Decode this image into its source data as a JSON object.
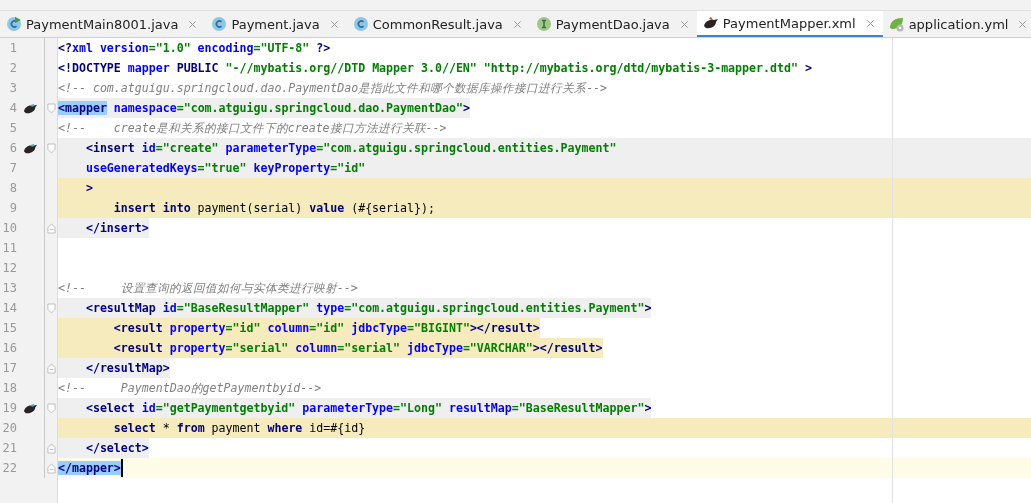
{
  "tabs": [
    {
      "label": "PaymentMain8001.java",
      "kind": "runnable-class",
      "selected": false
    },
    {
      "label": "Payment.java",
      "kind": "class",
      "selected": false
    },
    {
      "label": "CommonResult.java",
      "kind": "class",
      "selected": false
    },
    {
      "label": "PaymentDao.java",
      "kind": "interface",
      "selected": false
    },
    {
      "label": "PaymentMapper.xml",
      "kind": "mapper",
      "selected": true
    },
    {
      "label": "application.yml",
      "kind": "config",
      "selected": false
    }
  ],
  "lines": [
    {
      "number": "1",
      "kind": "plain",
      "tokens": [
        {
          "kind": "tag",
          "t": "<?"
        },
        {
          "kind": "attr",
          "t": "xml version"
        },
        {
          "kind": "str",
          "t": "=\"1.0\""
        },
        {
          "kind": "attr",
          "t": " encoding"
        },
        {
          "kind": "str",
          "t": "=\"UTF-8\""
        },
        {
          "kind": "tag",
          "t": " ?>"
        }
      ]
    },
    {
      "number": "2",
      "kind": "plain",
      "tokens": [
        {
          "kind": "tag",
          "t": "<!DOCTYPE "
        },
        {
          "kind": "attr",
          "t": "mapper"
        },
        {
          "kind": "tag",
          "t": " PUBLIC "
        },
        {
          "kind": "str",
          "t": "\"-//mybatis.org//DTD Mapper 3.0//EN\" \"http://mybatis.org/dtd/mybatis-3-mapper.dtd\""
        },
        {
          "kind": "tag",
          "t": " >"
        }
      ]
    },
    {
      "number": "3",
      "kind": "plain",
      "tokens": [
        {
          "kind": "comment",
          "t": "<!-- com.atguigu.springcloud.dao.PaymentDao是指此文件和哪个数据库操作接口进行关系-->"
        }
      ]
    },
    {
      "number": "4",
      "kind": "tag",
      "gutter_icon": true,
      "fold_start": true,
      "tokens": [
        {
          "kind": "match",
          "t": "<mapper"
        },
        {
          "kind": "attr",
          "t": " namespace"
        },
        {
          "kind": "str",
          "t": "=\"com.atguigu.springcloud.dao.PaymentDao\""
        },
        {
          "kind": "tag",
          "t": ">"
        }
      ]
    },
    {
      "number": "5",
      "kind": "plain",
      "tokens": [
        {
          "kind": "comment",
          "t": "<!--    create是和关系的接口文件下的create接口方法进行关联-->"
        }
      ]
    },
    {
      "number": "6",
      "kind": "tag-full",
      "gutter_icon": true,
      "fold_start": true,
      "tokens": [
        {
          "kind": "tag",
          "t": "    <insert"
        },
        {
          "kind": "attr",
          "t": " id"
        },
        {
          "kind": "str",
          "t": "=\"create\""
        },
        {
          "kind": "attr",
          "t": " parameterType"
        },
        {
          "kind": "str",
          "t": "=\"com.atguigu.springcloud.entities.Payment\""
        }
      ]
    },
    {
      "number": "7",
      "kind": "tag-full",
      "tokens": [
        {
          "kind": "attr",
          "t": "    useGeneratedKeys"
        },
        {
          "kind": "str",
          "t": "=\"true\""
        },
        {
          "kind": "attr",
          "t": " keyProperty"
        },
        {
          "kind": "str",
          "t": "=\"id\""
        }
      ]
    },
    {
      "number": "8",
      "kind": "body-full",
      "tokens": [
        {
          "kind": "tag",
          "t": "    >"
        }
      ]
    },
    {
      "number": "9",
      "kind": "body-full",
      "tokens": [
        {
          "kind": "keyword",
          "t": "        insert into"
        },
        {
          "kind": "text",
          "t": " payment(serial) "
        },
        {
          "kind": "keyword",
          "t": "value"
        },
        {
          "kind": "text",
          "t": " (#{serial});"
        }
      ]
    },
    {
      "number": "10",
      "kind": "tag",
      "fold_end": true,
      "tokens": [
        {
          "kind": "tag",
          "t": "    </insert>"
        }
      ]
    },
    {
      "number": "11",
      "kind": "plain"
    },
    {
      "number": "12",
      "kind": "plain"
    },
    {
      "number": "13",
      "kind": "plain",
      "tokens": [
        {
          "kind": "comment",
          "t": "<!--     设置查询的返回值如何与实体类进行映射-->"
        }
      ]
    },
    {
      "number": "14",
      "kind": "tag",
      "fold_start": true,
      "tokens": [
        {
          "kind": "tag",
          "t": "    <resultMap"
        },
        {
          "kind": "attr",
          "t": " id"
        },
        {
          "kind": "str",
          "t": "=\"BaseResultMapper\""
        },
        {
          "kind": "attr",
          "t": " type"
        },
        {
          "kind": "str",
          "t": "=\"com.atguigu.springcloud.entities.Payment\""
        },
        {
          "kind": "tag",
          "t": ">"
        }
      ]
    },
    {
      "number": "15",
      "kind": "body",
      "tokens": [
        {
          "kind": "tag",
          "t": "        <result"
        },
        {
          "kind": "attr",
          "t": " property"
        },
        {
          "kind": "str",
          "t": "=\"id\""
        },
        {
          "kind": "attr",
          "t": " column"
        },
        {
          "kind": "str",
          "t": "=\"id\""
        },
        {
          "kind": "attr",
          "t": " jdbcType"
        },
        {
          "kind": "str",
          "t": "=\"BIGINT\""
        },
        {
          "kind": "tag",
          "t": "></result>"
        }
      ]
    },
    {
      "number": "16",
      "kind": "body",
      "tokens": [
        {
          "kind": "tag",
          "t": "        <result"
        },
        {
          "kind": "attr",
          "t": " property"
        },
        {
          "kind": "str",
          "t": "=\"serial\""
        },
        {
          "kind": "attr",
          "t": " column"
        },
        {
          "kind": "str",
          "t": "=\"serial\""
        },
        {
          "kind": "attr",
          "t": " jdbcType"
        },
        {
          "kind": "str",
          "t": "=\"VARCHAR\""
        },
        {
          "kind": "tag",
          "t": "></result>"
        }
      ]
    },
    {
      "number": "17",
      "kind": "tag",
      "fold_end": true,
      "tokens": [
        {
          "kind": "tag",
          "t": "    </resultMap>"
        }
      ]
    },
    {
      "number": "18",
      "kind": "plain",
      "tokens": [
        {
          "kind": "comment",
          "t": "<!--     PaymentDao的getPaymentbyid-->"
        }
      ]
    },
    {
      "number": "19",
      "kind": "tag",
      "gutter_icon": true,
      "fold_start": true,
      "tokens": [
        {
          "kind": "tag",
          "t": "    <select"
        },
        {
          "kind": "attr",
          "t": " id"
        },
        {
          "kind": "str",
          "t": "=\"getPaymentgetbyid\""
        },
        {
          "kind": "attr",
          "t": " parameterType"
        },
        {
          "kind": "str",
          "t": "=\"Long\""
        },
        {
          "kind": "attr",
          "t": " resultMap"
        },
        {
          "kind": "str",
          "t": "=\"BaseResultMapper\""
        },
        {
          "kind": "tag",
          "t": ">"
        }
      ]
    },
    {
      "number": "20",
      "kind": "body-full",
      "tokens": [
        {
          "kind": "keyword",
          "t": "        select"
        },
        {
          "kind": "text",
          "t": " * "
        },
        {
          "kind": "keyword",
          "t": "from"
        },
        {
          "kind": "text",
          "t": " payment "
        },
        {
          "kind": "keyword",
          "t": "where"
        },
        {
          "kind": "text",
          "t": " id=#{id}"
        }
      ]
    },
    {
      "number": "21",
      "kind": "tag",
      "fold_end": true,
      "tokens": [
        {
          "kind": "tag",
          "t": "    </select>"
        }
      ]
    },
    {
      "number": "22",
      "kind": "current",
      "fold_end": true,
      "caret": true,
      "tokens": [
        {
          "kind": "match",
          "t": "</mapper>"
        }
      ]
    }
  ]
}
